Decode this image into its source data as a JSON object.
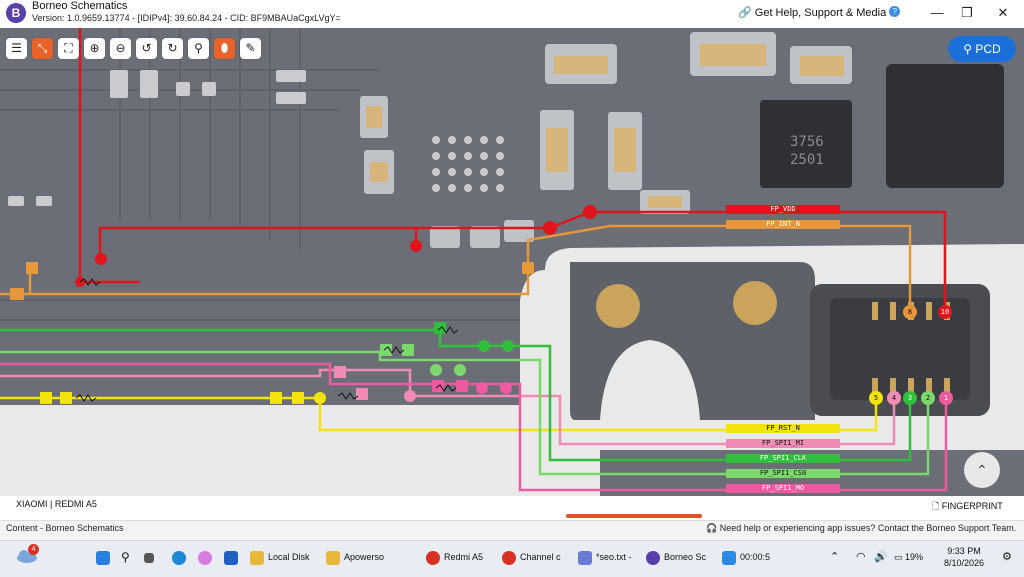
{
  "window": {
    "app_name": "Borneo Schematics",
    "version_line": "Version: 1.0.9659.13774 - [IDIPv4]: 39.60.84.24 - CID: BF9MBAUaCgxLVgY=",
    "help_link": "Get Help, Support & Media",
    "minimize": "—",
    "maximize": "❐",
    "close": "✕"
  },
  "toolbar": {
    "buttons": [
      {
        "name": "list-button",
        "icon": "☰"
      },
      {
        "name": "fit-button",
        "icon": "⤡",
        "active": true
      },
      {
        "name": "fullscreen-button",
        "icon": "⛶"
      },
      {
        "name": "zoom-in-button",
        "icon": "⊕"
      },
      {
        "name": "zoom-out-button",
        "icon": "⊖"
      },
      {
        "name": "rotate-left-button",
        "icon": "↺"
      },
      {
        "name": "rotate-right-button",
        "icon": "↻"
      },
      {
        "name": "search-button",
        "icon": "⚲"
      },
      {
        "name": "mouse-button",
        "icon": "⬮",
        "active": true
      },
      {
        "name": "draw-button",
        "icon": "✎"
      }
    ],
    "pcd_label": "PCD"
  },
  "nets": [
    {
      "label": "FP_VDD",
      "color": "#e0141b"
    },
    {
      "label": "FP_INT_N",
      "color": "#e8963a"
    },
    {
      "label": "FP_RST_N",
      "color": "#f2e40a"
    },
    {
      "label": "FP_SPI1_MI",
      "color": "#f08bb8"
    },
    {
      "label": "FP_SPI1_CLK",
      "color": "#2fbf3a"
    },
    {
      "label": "FP_SPI1_CS0",
      "color": "#7bd86a"
    },
    {
      "label": "FP_SPI1_MO",
      "color": "#ee5aa0"
    }
  ],
  "connector_pins": [
    "8",
    "10",
    "5",
    "4",
    "3",
    "2",
    "1"
  ],
  "footer": {
    "device": "XIAOMI | REDMI A5",
    "section": "FINGERPRINT"
  },
  "statusbar": {
    "left": "Content - Borneo Schematics",
    "right": "Need help or experiencing app issues? Contact the Borneo Support Team."
  },
  "taskbar": {
    "notification_count": "4",
    "items": [
      {
        "label": "Local Disk",
        "color": "#e8b83a"
      },
      {
        "label": "Apowerso",
        "color": "#e8b83a"
      },
      {
        "label": "Redmi A5",
        "color": "#d93025"
      },
      {
        "label": "Channel c",
        "color": "#d93025"
      },
      {
        "label": "*seo.txt -",
        "color": "#6a7bd6"
      },
      {
        "label": "Borneo Sc",
        "color": "#5b3fa8"
      },
      {
        "label": "00:00:5",
        "color": "#2a8ae6"
      }
    ],
    "battery": "19%",
    "time": "9:33 PM",
    "date": "8/10/2026"
  }
}
